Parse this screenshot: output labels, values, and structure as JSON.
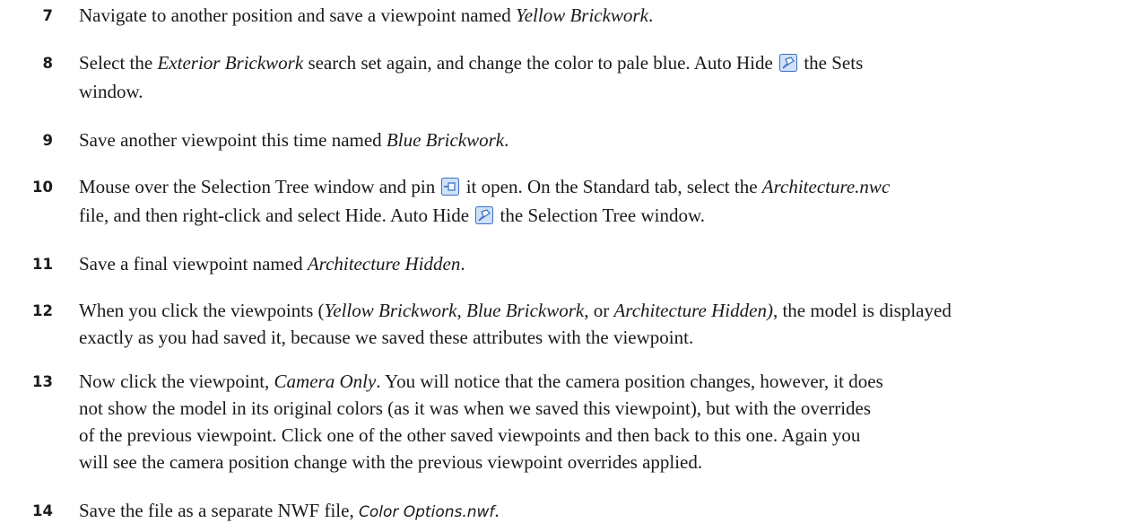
{
  "steps": [
    {
      "number": "7",
      "lines": [
        [
          {
            "t": "Navigate to another position and save a viewpoint named "
          },
          {
            "t": "Yellow Brickwork",
            "i": true
          },
          {
            "t": "."
          }
        ]
      ]
    },
    {
      "number": "8",
      "lines": [
        [
          {
            "t": "Select the "
          },
          {
            "t": "Exterior Brickwork",
            "i": true
          },
          {
            "t": " search set again, and change the color to pale blue. Auto Hide "
          },
          {
            "icon": "auto-hide-icon"
          },
          {
            "t": " the Sets"
          }
        ],
        [
          {
            "t": "window."
          }
        ]
      ]
    },
    {
      "number": "9",
      "lines": [
        [
          {
            "t": "Save another viewpoint this time named "
          },
          {
            "t": "Blue Brickwork",
            "i": true
          },
          {
            "t": "."
          }
        ]
      ]
    },
    {
      "number": "10",
      "lines": [
        [
          {
            "t": "Mouse over the Selection Tree window and pin "
          },
          {
            "icon": "pin-icon"
          },
          {
            "t": " it open. On the Standard tab, select the "
          },
          {
            "t": "Architecture.nwc",
            "i": true
          }
        ],
        [
          {
            "t": "file, and then right-click and select Hide. Auto Hide "
          },
          {
            "icon": "auto-hide-icon"
          },
          {
            "t": " the Selection Tree window."
          }
        ]
      ]
    },
    {
      "number": "11",
      "lines": [
        [
          {
            "t": "Save a final viewpoint named "
          },
          {
            "t": "Architecture Hidden",
            "i": true
          },
          {
            "t": "."
          }
        ]
      ]
    },
    {
      "number": "12",
      "lines": [
        [
          {
            "t": "When you click the viewpoints ("
          },
          {
            "t": "Yellow Brickwork",
            "i": true
          },
          {
            "t": ", "
          },
          {
            "t": "Blue Brickwork",
            "i": true
          },
          {
            "t": ", or "
          },
          {
            "t": "Architecture Hidden)",
            "i": true
          },
          {
            "t": ", the model is displayed"
          }
        ],
        [
          {
            "t": "exactly as you had saved it, because we saved these attributes with the viewpoint."
          }
        ]
      ]
    },
    {
      "number": "13",
      "lines": [
        [
          {
            "t": "Now click the viewpoint, "
          },
          {
            "t": "Camera Only",
            "i": true
          },
          {
            "t": ". You will notice that the camera position changes, however, it does"
          }
        ],
        [
          {
            "t": "not show the model in its original colors (as it was when we saved this viewpoint), but with the overrides"
          }
        ],
        [
          {
            "t": "of the previous viewpoint. Click one of the other saved viewpoints and then back to this one. Again you"
          }
        ],
        [
          {
            "t": "will see the camera position change with the previous viewpoint overrides applied."
          }
        ]
      ]
    },
    {
      "number": "14",
      "lines": [
        [
          {
            "t": "Save the file as a separate NWF file, "
          },
          {
            "t": "Color Options.nwf",
            "i": true,
            "sans": true
          },
          {
            "t": "."
          }
        ]
      ]
    }
  ],
  "colors": {
    "text": "#1a1a1a",
    "icon_blue": "#3b6fc2",
    "icon_light": "#cfe1f7"
  }
}
